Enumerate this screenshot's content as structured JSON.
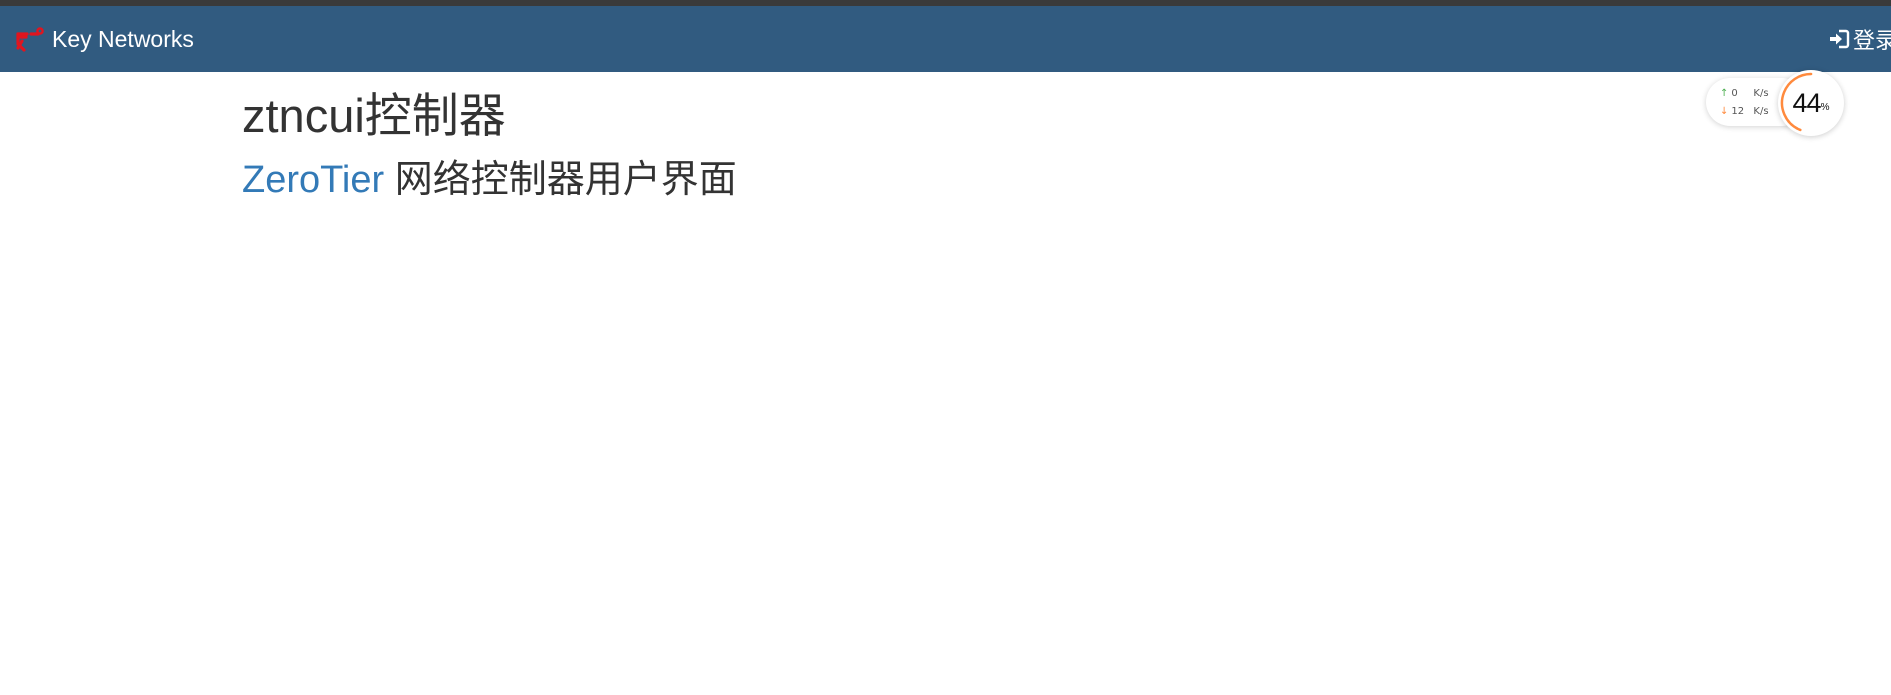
{
  "navbar": {
    "brand_icon": "network-logo-icon",
    "brand_label": "Key Networks",
    "login_icon": "sign-in-icon",
    "login_label": "登录",
    "background_color": "#315b80",
    "logo_color": "#e0151f"
  },
  "main": {
    "title": "ztncui控制器",
    "subtitle_link": "ZeroTier",
    "subtitle_rest": " 网络控制器用户界面",
    "link_color": "#337ab7"
  },
  "speed_widget": {
    "upload_value": "0",
    "upload_unit": "K/s",
    "download_value": "12",
    "download_unit": "K/s",
    "up_arrow": "↑",
    "down_arrow": "↓",
    "usage_percent": 44,
    "usage_value": "44",
    "usage_unit": "%",
    "gauge_color": "#ff8a3d"
  }
}
